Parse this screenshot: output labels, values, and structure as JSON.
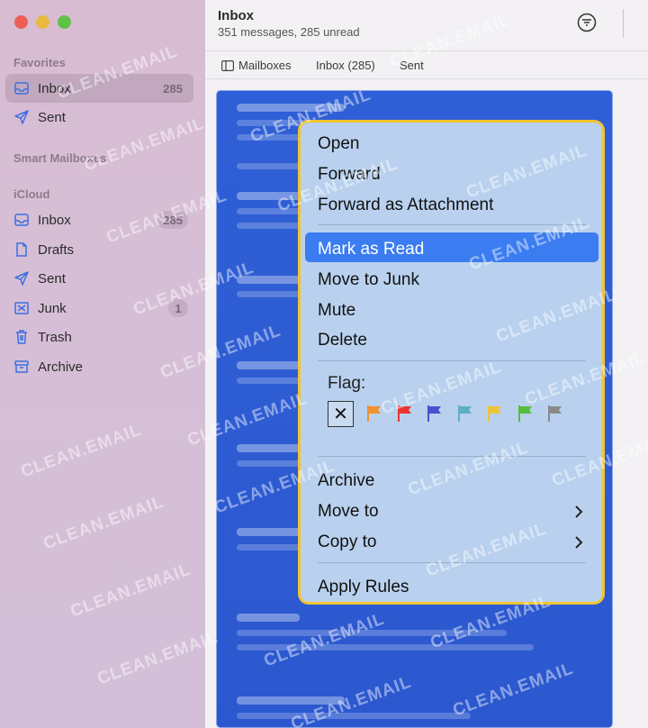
{
  "sidebar": {
    "favorites_label": "Favorites",
    "smart_mailboxes_label": "Smart Mailboxes",
    "icloud_label": "iCloud",
    "favorites": [
      {
        "label": "Inbox",
        "icon": "inbox-icon",
        "count": "285"
      },
      {
        "label": "Sent",
        "icon": "sent-icon",
        "count": ""
      }
    ],
    "icloud": [
      {
        "label": "Inbox",
        "icon": "inbox-icon",
        "count": "285"
      },
      {
        "label": "Drafts",
        "icon": "drafts-icon",
        "count": ""
      },
      {
        "label": "Sent",
        "icon": "sent-icon",
        "count": ""
      },
      {
        "label": "Junk",
        "icon": "junk-icon",
        "count": "1"
      },
      {
        "label": "Trash",
        "icon": "trash-icon",
        "count": ""
      },
      {
        "label": "Archive",
        "icon": "archive-icon",
        "count": ""
      }
    ]
  },
  "header": {
    "title": "Inbox",
    "subtitle": "351 messages, 285 unread"
  },
  "tabs": [
    {
      "label": "Mailboxes"
    },
    {
      "label": "Inbox (285)"
    },
    {
      "label": "Sent"
    }
  ],
  "context_menu": {
    "items": [
      {
        "label": "Open"
      },
      {
        "label": "Forward"
      },
      {
        "label": "Forward as Attachment"
      },
      {
        "label": "Mark as Read"
      },
      {
        "label": "Move to Junk"
      },
      {
        "label": "Mute"
      },
      {
        "label": "Delete"
      },
      {
        "label": "Archive"
      },
      {
        "label": "Move to"
      },
      {
        "label": "Copy to"
      },
      {
        "label": "Apply Rules"
      }
    ],
    "highlighted_item": "Mark as Read",
    "flag_label": "Flag:",
    "flag_colors": [
      "#f0922e",
      "#e8362f",
      "#4a4fd0",
      "#5bb0c4",
      "#efc43d",
      "#54be3b",
      "#8a8a8a"
    ]
  },
  "watermark": "CLEAN.EMAIL",
  "colors": {
    "accent": "#3b7cf0",
    "menu_border": "#f2c530",
    "list_bg": "#2f5fd6"
  }
}
